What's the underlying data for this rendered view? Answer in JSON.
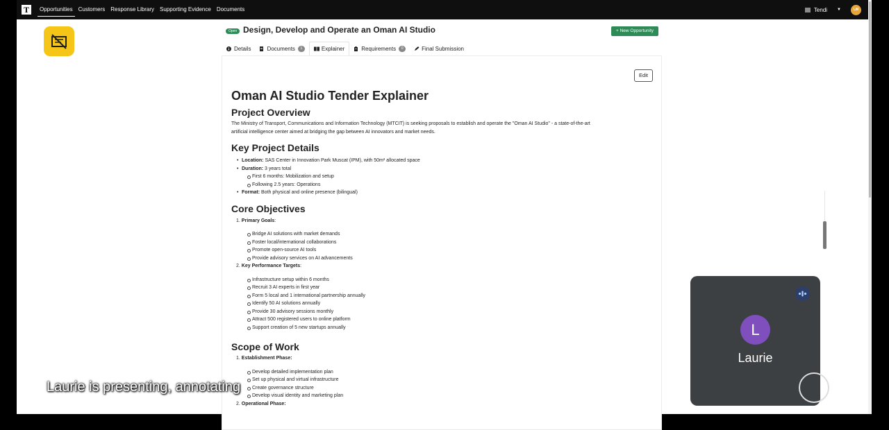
{
  "topbar": {
    "logo": "T",
    "nav": [
      "Opportunities",
      "Customers",
      "Response Library",
      "Supporting Evidence",
      "Documents"
    ],
    "active_nav": "Opportunities",
    "user_name": "Tendi",
    "avatar_initials": "LM"
  },
  "opportunity": {
    "status": "Open",
    "title": "Design, Develop and Operate an Oman AI Studio",
    "new_button": "+ New Opportunity"
  },
  "tabs": [
    {
      "label": "Details",
      "icon": "info-icon"
    },
    {
      "label": "Documents",
      "icon": "document-icon",
      "count": "1"
    },
    {
      "label": "Explainer",
      "icon": "book-icon",
      "active": true
    },
    {
      "label": "Requirements",
      "icon": "clipboard-icon",
      "count": "0"
    },
    {
      "label": "Final Submission",
      "icon": "pen-icon"
    }
  ],
  "edit_button": "Edit",
  "doc": {
    "title": "Oman AI Studio Tender Explainer",
    "overview_heading": "Project Overview",
    "overview_text_1": "The Ministry of Transport, Communications and Information Technology (MTCIT) is seeking proposals to establish and operate the \"Oman AI Studio\" - a state-of-the-art",
    "overview_text_2": "artificial intelligence center aimed at bridging the gap between AI innovators and market needs.",
    "details_heading": "Key Project Details",
    "location_label": "Location:",
    "location_value": " SAS Center in Innovation Park Muscat (IPM), with 50m² allocated space",
    "duration_label": "Duration:",
    "duration_value": " 3 years total",
    "duration_sub": [
      "First 6 months: Mobilization and setup",
      "Following 2.5 years: Operations"
    ],
    "format_label": "Format:",
    "format_value": " Both physical and online presence (bilingual)",
    "objectives_heading": "Core Objectives",
    "goals_num": "1. ",
    "goals_label": "Primary Goals",
    "goals": [
      "Bridge AI solutions with market demands",
      "Foster local/international collaborations",
      "Promote open-source AI tools",
      "Provide advisory services on AI advancements"
    ],
    "targets_num": "2. ",
    "targets_label": "Key Performance Targets",
    "targets": [
      "Infrastructure setup within 6 months",
      "Recruit 3 AI experts in first year",
      "Form 5 local and 1 international partnership annually",
      "Identify 50 AI solutions annually",
      "Provide 30 advisory sessions monthly",
      "Attract 500 registered users to online platform",
      "Support creation of 5 new startups annually"
    ],
    "scope_heading": "Scope of Work",
    "establishment_num": "1. ",
    "establishment_label": "Establishment Phase:",
    "establishment": [
      "Develop detailed implementation plan",
      "Set up physical and virtual infrastructure",
      "Create governance structure",
      "Develop visual identity and marketing plan"
    ],
    "operational_num": "2. ",
    "operational_label": "Operational Phase:"
  },
  "meeting": {
    "participant_name": "Laurie",
    "participant_initial": "L",
    "caption": "Laurie is presenting, annotating"
  }
}
